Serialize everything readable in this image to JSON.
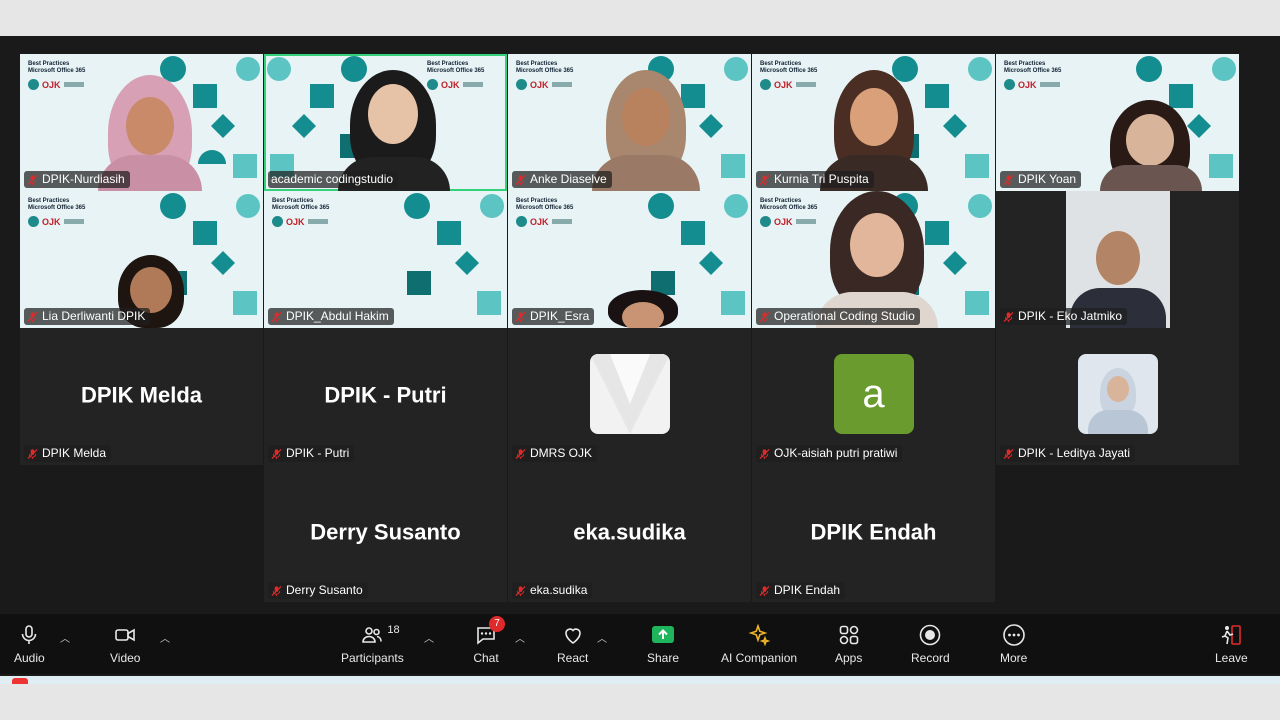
{
  "participants_grid": [
    {
      "name": "DPIK-Nurdiasih",
      "type": "video",
      "muted": true
    },
    {
      "name": "academic codingstudio",
      "type": "video",
      "muted": false,
      "active_speaker": true
    },
    {
      "name": "Anke Diaselve",
      "type": "video",
      "muted": true
    },
    {
      "name": "Kurnia Tri Puspita",
      "type": "video",
      "muted": true
    },
    {
      "name": "DPIK Yoan",
      "type": "video",
      "muted": true
    },
    {
      "name": "Lia Derliwanti DPIK",
      "type": "video",
      "muted": true
    },
    {
      "name": "DPIK_Abdul Hakim",
      "type": "video",
      "muted": true
    },
    {
      "name": "DPIK_Esra",
      "type": "video",
      "muted": true
    },
    {
      "name": "Operational Coding Studio",
      "type": "video",
      "muted": true
    },
    {
      "name": "DPIK - Eko Jatmiko",
      "type": "video",
      "muted": true
    },
    {
      "name": "DPIK Melda",
      "display": "DPIK Melda",
      "type": "name",
      "muted": true
    },
    {
      "name": "DPIK - Putri",
      "display": "DPIK - Putri",
      "type": "name",
      "muted": true
    },
    {
      "name": "DMRS OJK",
      "type": "avatar",
      "muted": true
    },
    {
      "name": "OJK-aisiah putri pratiwi",
      "type": "avatar",
      "avatar_letter": "a",
      "avatar_color": "#6a9b2e",
      "muted": true
    },
    {
      "name": "DPIK - Leditya Jayati",
      "type": "avatar",
      "muted": true
    },
    {
      "name": "Derry Susanto",
      "display": "Derry Susanto",
      "type": "name",
      "muted": true
    },
    {
      "name": "eka.sudika",
      "display": "eka.sudika",
      "type": "name",
      "muted": true
    },
    {
      "name": "DPIK Endah",
      "display": "DPIK Endah",
      "type": "name",
      "muted": true
    }
  ],
  "virtual_background": {
    "title_line1": "Best Practices",
    "title_line2": "Microsoft Office 365",
    "logo_text": "OJK"
  },
  "toolbar": {
    "audio": "Audio",
    "video": "Video",
    "participants": "Participants",
    "participants_count": "18",
    "chat": "Chat",
    "chat_badge": "7",
    "react": "React",
    "share": "Share",
    "ai_companion": "AI Companion",
    "apps": "Apps",
    "record": "Record",
    "more": "More",
    "leave": "Leave"
  },
  "colors": {
    "active_speaker_border": "#33d17a",
    "share_green": "#1fb55c",
    "muted_red": "#e02a2a",
    "teal_pattern": "#138d90"
  }
}
